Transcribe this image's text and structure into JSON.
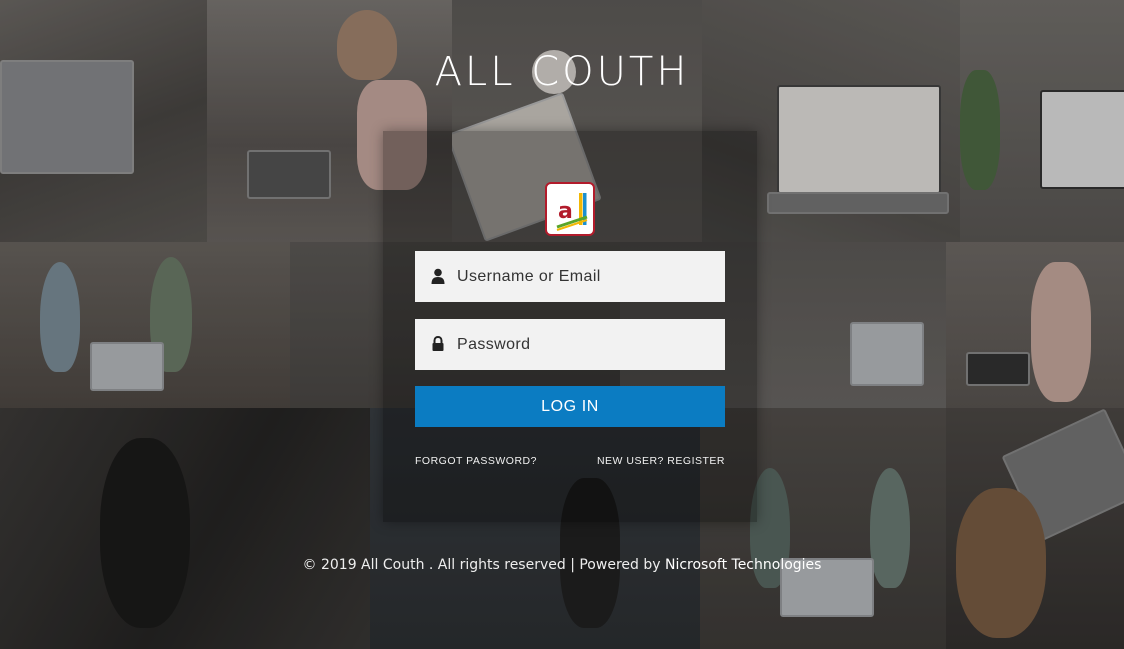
{
  "app": {
    "title": "ALL COUTH"
  },
  "logo": {
    "icon": "all-couth-logo-icon",
    "lettering": "a",
    "border_color": "#b21b2b",
    "bar_colors": [
      "#f2b705",
      "#1a8fd1",
      "#5aa52a"
    ]
  },
  "login_form": {
    "username_placeholder": "Username or Email",
    "username_icon": "user-icon",
    "password_placeholder": "Password",
    "password_icon": "lock-icon",
    "login_label": "LOG IN",
    "forgot_label": "FORGOT PASSWORD?",
    "register_label": "NEW USER? REGISTER",
    "accent_color": "#0b7cc2"
  },
  "footer": {
    "copyright": "© 2019 All Couth . All rights reserved | Powered by ",
    "powered_by_link": "Nicrosoft Technologies"
  }
}
